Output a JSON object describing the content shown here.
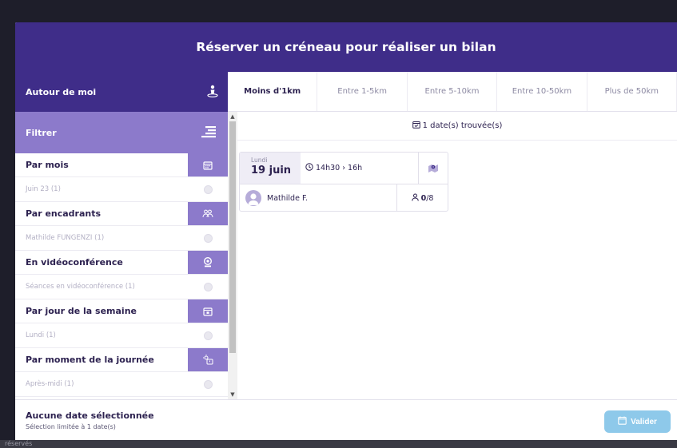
{
  "modal": {
    "title": "Réserver un créneau pour réaliser un bilan"
  },
  "backdrop": {
    "bottom_text": "réservés"
  },
  "sidebar": {
    "around_me": "Autour de moi",
    "filter_label": "Filtrer",
    "sections": [
      {
        "label": "Par mois",
        "icon": "calendar-icon",
        "option": "Juin 23 (1)"
      },
      {
        "label": "Par encadrants",
        "icon": "people-icon",
        "option": "Mathilde FUNGENZI (1)"
      },
      {
        "label": "En vidéoconférence",
        "icon": "webcam-icon",
        "option": "Séances en vidéoconférence (1)"
      },
      {
        "label": "Par jour de la semaine",
        "icon": "calendar-day-icon",
        "option": "Lundi (1)"
      },
      {
        "label": "Par moment de la journée",
        "icon": "sun-time-icon",
        "option": "Après-midi (1)"
      }
    ]
  },
  "tabs": [
    "Moins d'1km",
    "Entre 1-5km",
    "Entre 5-10km",
    "Entre 10-50km",
    "Plus de 50km"
  ],
  "results": {
    "found_text": "1 date(s) trouvée(s)"
  },
  "slot": {
    "day": "Lundi",
    "date": "19 juin",
    "time": "14h30 › 16h",
    "person": "Mathilde F.",
    "seats_taken": "0",
    "seats_total": "/8"
  },
  "footer": {
    "title": "Aucune date sélectionnée",
    "subtitle": "Sélection limitée à 1 date(s)",
    "validate_label": "Valider"
  },
  "colors": {
    "primary": "#3f2d89",
    "secondary": "#8c7acb",
    "button": "#8ec9ea"
  }
}
